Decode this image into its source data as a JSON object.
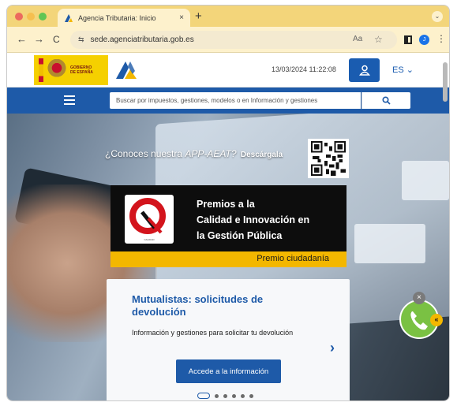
{
  "browser": {
    "tab_title": "Agencia Tributaria: Inicio",
    "tab_close_glyph": "×",
    "new_tab_glyph": "+",
    "tab_menu_glyph": "⌄",
    "url": "sede.agenciatributaria.gob.es",
    "back_glyph": "←",
    "forward_glyph": "→",
    "reload_glyph": "C",
    "site_info_glyph": "⇆",
    "translate_glyph": "Aa",
    "star_glyph": "☆",
    "profile_initial": "J",
    "menu_glyph": "⋮"
  },
  "header": {
    "gov_text_line1": "GOBIERNO",
    "gov_text_line2": "DE ESPAÑA",
    "datetime": "13/03/2024 11:22:08",
    "language": "ES ⌄"
  },
  "search": {
    "placeholder": "Buscar por impuestos, gestiones, modelos o en Información y gestiones"
  },
  "hero": {
    "app_promo_prefix": "¿Conoces nuestra ",
    "app_promo_name": "APP-AEAT?",
    "app_promo_download": "Descárgala",
    "award_line1": "Premios a la",
    "award_line2": "Calidad e Innovación en",
    "award_line3": "la Gestión Pública",
    "award_bar": "Premio ciudadanía",
    "award_logo_caption": "CALIDAD"
  },
  "card": {
    "title": "Mutualistas: solicitudes de devolución",
    "description": "Información y gestiones para solicitar tu devolución",
    "cta": "Accede a la información",
    "next_glyph": "›"
  },
  "carousel": {
    "slides": 6,
    "active": 0
  },
  "chat": {
    "close_glyph": "×",
    "arrow_glyph": "«"
  },
  "colors": {
    "brand_blue": "#1e5aa8",
    "award_yellow": "#f3b700",
    "tab_yellow": "#f3d57a",
    "chat_green": "#7ac143"
  }
}
